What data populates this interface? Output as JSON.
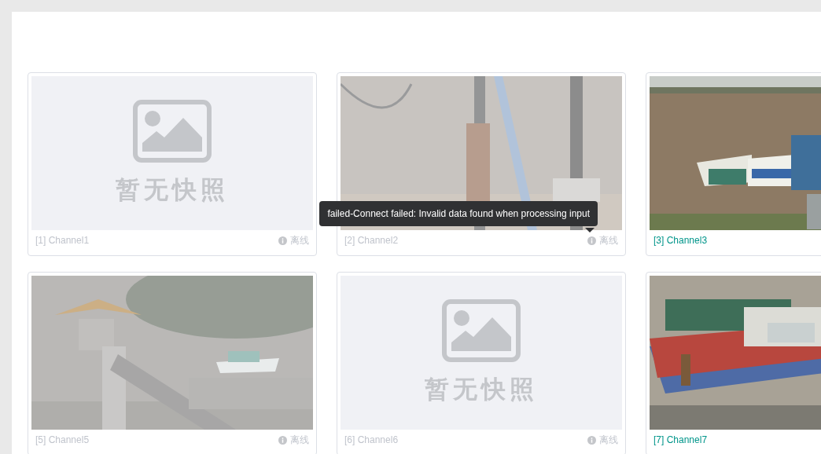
{
  "channels": [
    {
      "label": "[1] Channel1",
      "thumbnail": {
        "kind": "placeholder",
        "text": "暂无快照"
      },
      "online": false,
      "status": "离线"
    },
    {
      "label": "[2] Channel2",
      "online": false,
      "status": "离线",
      "tooltip": "failed-Connect failed: Invalid data found when processing input"
    },
    {
      "label": "[3] Channel3",
      "online": true
    },
    {
      "label": "[5] Channel5",
      "online": false,
      "status": "离线"
    },
    {
      "label": "[6] Channel6",
      "thumbnail": {
        "kind": "placeholder",
        "text": "暂无快照"
      },
      "online": false,
      "status": "离线"
    },
    {
      "label": "[7] Channel7",
      "online": true
    }
  ]
}
